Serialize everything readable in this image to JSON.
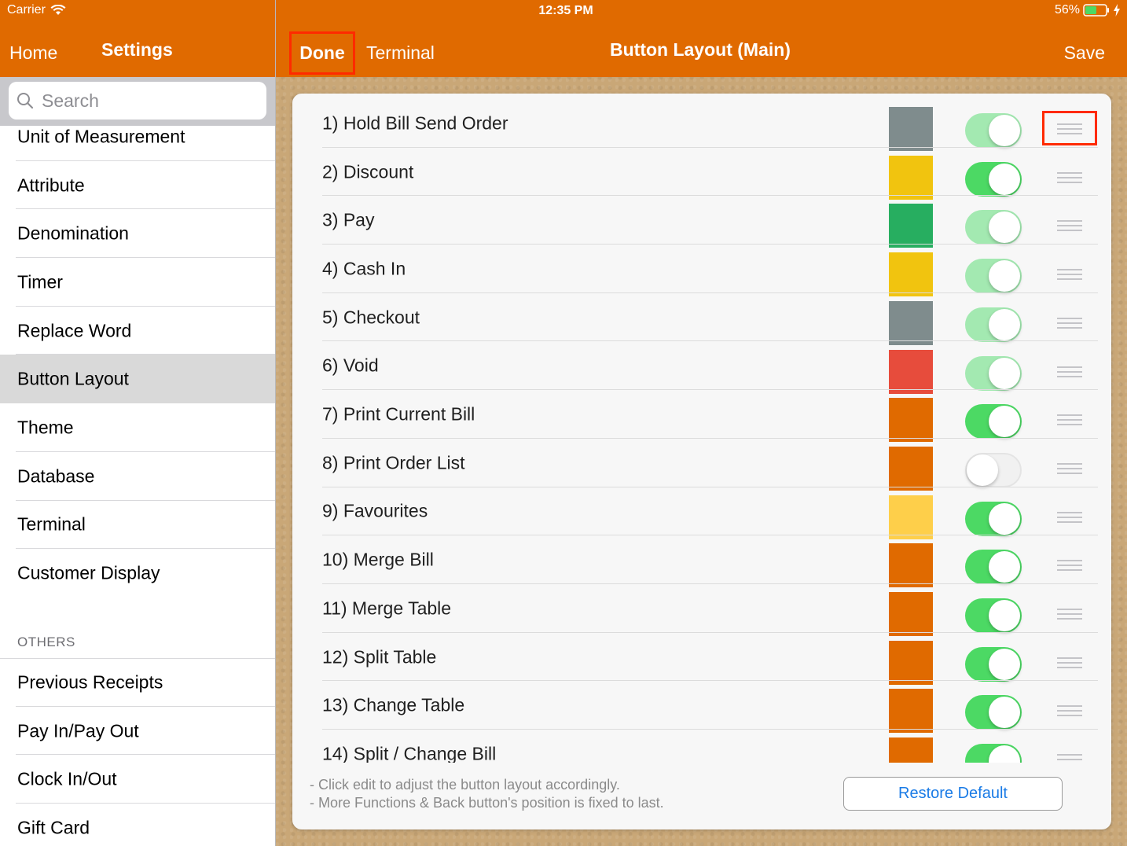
{
  "status_bar": {
    "carrier": "Carrier",
    "time": "12:35 PM",
    "battery": "56%",
    "battery_level": 0.56
  },
  "sidebar": {
    "back_label": "Home",
    "title": "Settings",
    "search_placeholder": "Search",
    "items": [
      {
        "label": "Unit of Measurement"
      },
      {
        "label": "Attribute"
      },
      {
        "label": "Denomination"
      },
      {
        "label": "Timer"
      },
      {
        "label": "Replace Word"
      },
      {
        "label": "Button Layout",
        "selected": true
      },
      {
        "label": "Theme"
      },
      {
        "label": "Database"
      },
      {
        "label": "Terminal"
      },
      {
        "label": "Customer Display"
      }
    ],
    "section_header": "OTHERS",
    "others": [
      {
        "label": "Previous Receipts"
      },
      {
        "label": "Pay In/Pay Out"
      },
      {
        "label": "Clock In/Out"
      },
      {
        "label": "Gift Card"
      }
    ]
  },
  "header": {
    "done_label": "Done",
    "back_label": "Terminal",
    "title": "Button Layout (Main)",
    "save_label": "Save"
  },
  "colors": {
    "brand": "#e06a00",
    "toggle_on": "#4cd964",
    "toggle_on_disabled": "#a3e9b1",
    "highlight": "#ff2a00",
    "link": "#1a7be6"
  },
  "buttons": [
    {
      "label": "1) Hold Bill Send Order",
      "color": "#7f8c8d",
      "toggle": "on-disabled"
    },
    {
      "label": "2) Discount",
      "color": "#f1c40f",
      "toggle": "on"
    },
    {
      "label": "3) Pay",
      "color": "#27ae60",
      "toggle": "on-disabled"
    },
    {
      "label": "4) Cash In",
      "color": "#f1c40f",
      "toggle": "on-disabled"
    },
    {
      "label": "5) Checkout",
      "color": "#7f8c8d",
      "toggle": "on-disabled"
    },
    {
      "label": "6) Void",
      "color": "#e74c3c",
      "toggle": "on-disabled"
    },
    {
      "label": "7) Print Current Bill",
      "color": "#e06a00",
      "toggle": "on"
    },
    {
      "label": "8) Print Order List",
      "color": "#e06a00",
      "toggle": "off"
    },
    {
      "label": "9) Favourites",
      "color": "#fecf4a",
      "toggle": "on"
    },
    {
      "label": "10) Merge Bill",
      "color": "#e06a00",
      "toggle": "on"
    },
    {
      "label": "11) Merge Table",
      "color": "#e06a00",
      "toggle": "on"
    },
    {
      "label": "12) Split Table",
      "color": "#e06a00",
      "toggle": "on"
    },
    {
      "label": "13) Change Table",
      "color": "#e06a00",
      "toggle": "on"
    },
    {
      "label": "14) Split / Change Bill",
      "color": "#e06a00",
      "toggle": "on"
    }
  ],
  "notes": [
    "- Click edit to adjust the button layout accordingly.",
    "- More Functions & Back button's position is fixed to last."
  ],
  "restore_label": "Restore Default"
}
